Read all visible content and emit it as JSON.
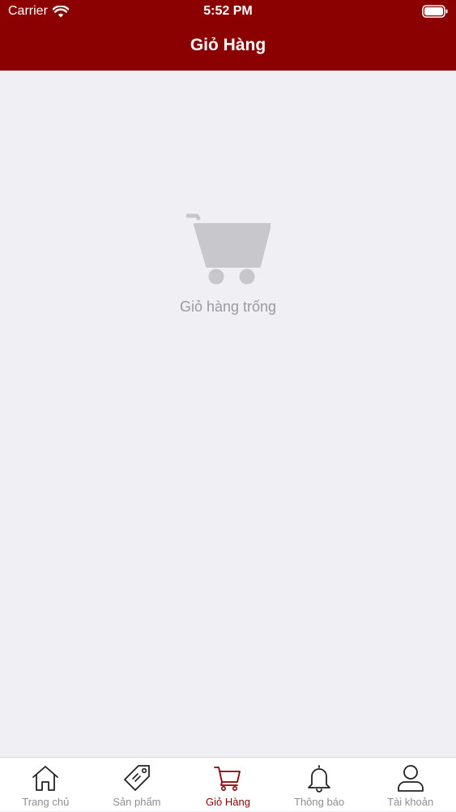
{
  "status_bar": {
    "carrier": "Carrier",
    "time": "5:52 PM"
  },
  "header": {
    "title": "Giỏ Hàng",
    "background_color": "#8b0000"
  },
  "empty_state": {
    "icon": "cart-icon",
    "message": "Giỏ hàng trống"
  },
  "tabbar": {
    "active_color": "#8b0000",
    "items": [
      {
        "label": "Trang chủ",
        "icon": "home-icon",
        "active": false
      },
      {
        "label": "Sản phẩm",
        "icon": "tag-icon",
        "active": false
      },
      {
        "label": "Giỏ Hàng",
        "icon": "cart-icon",
        "active": true
      },
      {
        "label": "Thông báo",
        "icon": "bell-icon",
        "active": false
      },
      {
        "label": "Tài khoản",
        "icon": "user-icon",
        "active": false
      }
    ]
  }
}
